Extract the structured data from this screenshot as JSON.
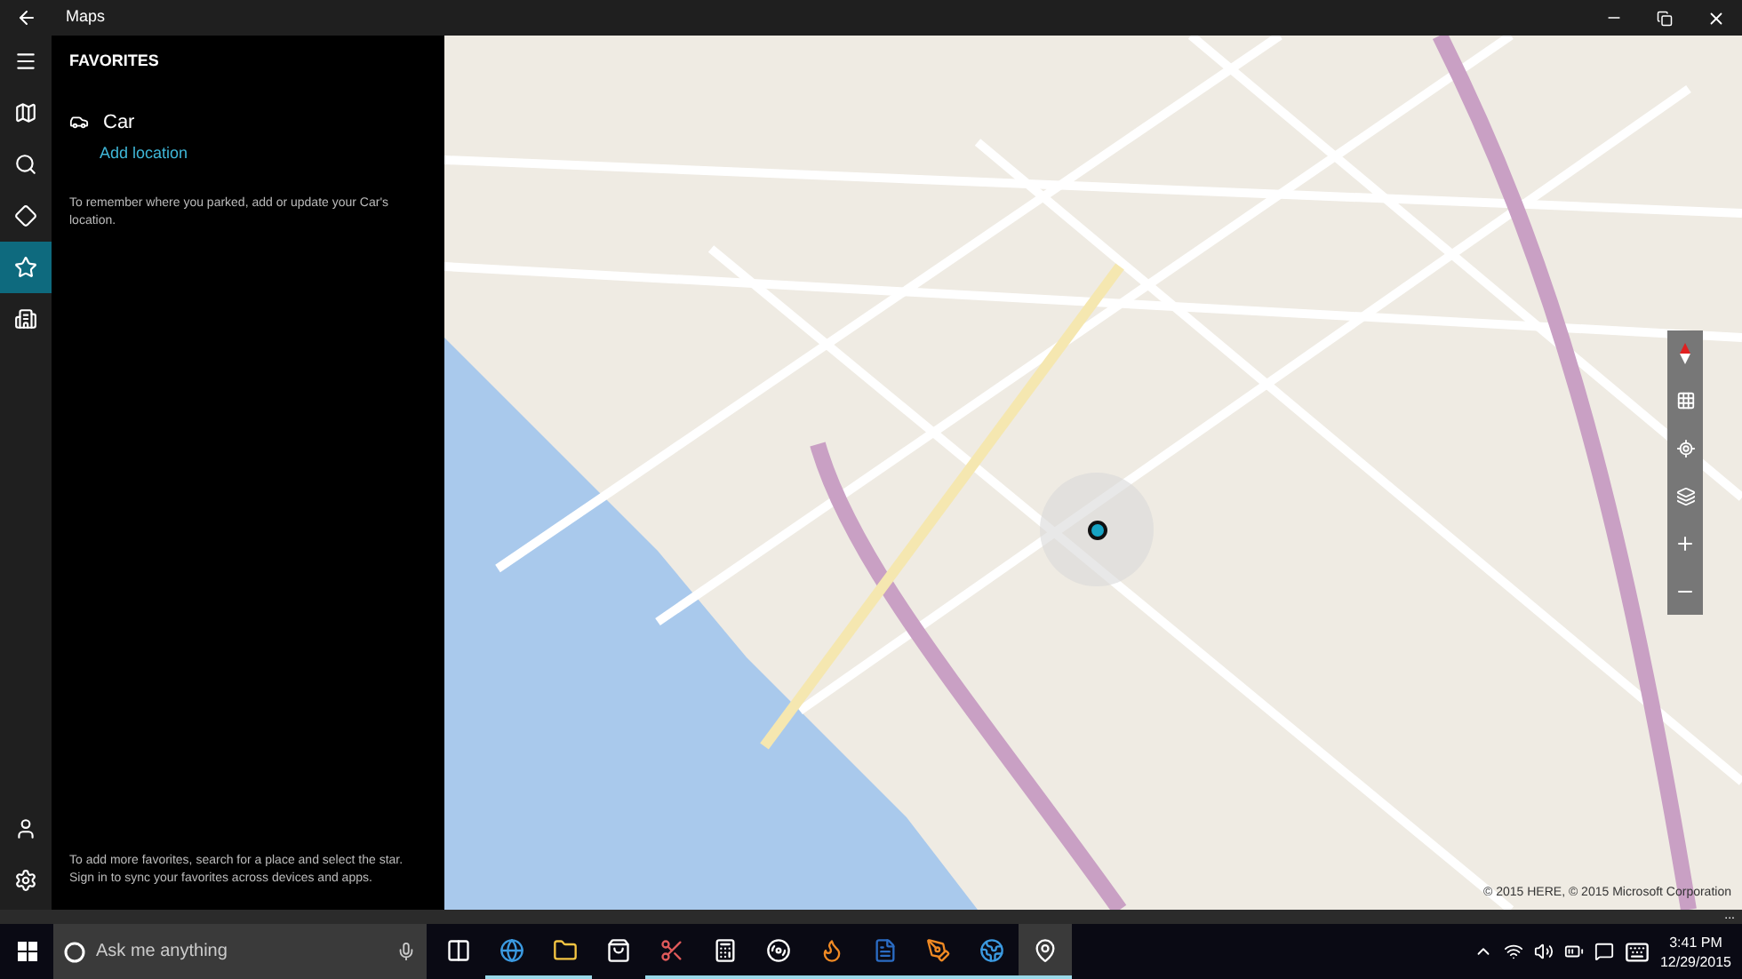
{
  "window": {
    "title": "Maps"
  },
  "nav": {
    "top": [
      {
        "kind": "menu",
        "selected": false
      },
      {
        "kind": "map",
        "selected": false
      },
      {
        "kind": "search",
        "selected": false
      },
      {
        "kind": "directions",
        "selected": false
      },
      {
        "kind": "favorites",
        "selected": true
      },
      {
        "kind": "cities",
        "selected": false
      }
    ],
    "bottom": [
      {
        "kind": "account",
        "selected": false
      },
      {
        "kind": "settings",
        "selected": false
      }
    ]
  },
  "panel": {
    "heading": "FAVORITES",
    "favorite": {
      "name": "Car",
      "action": "Add location"
    },
    "hint": "To remember where you parked, add or update your Car's location.",
    "footer": "To add more favorites, search for a place and select the star. Sign in to sync your favorites across devices and apps."
  },
  "map": {
    "copyright": "© 2015 HERE, © 2015 Microsoft Corporation",
    "more": "..."
  },
  "taskbar": {
    "search_placeholder": "Ask me anything",
    "apps": [
      {
        "kind": "taskview",
        "running": false,
        "selected": false
      },
      {
        "kind": "edge",
        "running": true,
        "selected": false
      },
      {
        "kind": "explorer",
        "running": true,
        "selected": false
      },
      {
        "kind": "store",
        "running": false,
        "selected": false
      },
      {
        "kind": "snip",
        "running": true,
        "selected": false
      },
      {
        "kind": "calculator",
        "running": true,
        "selected": false
      },
      {
        "kind": "groove",
        "running": true,
        "selected": false
      },
      {
        "kind": "firefox",
        "running": true,
        "selected": false
      },
      {
        "kind": "word",
        "running": true,
        "selected": false
      },
      {
        "kind": "illustrator",
        "running": true,
        "selected": false
      },
      {
        "kind": "ie",
        "running": true,
        "selected": false
      },
      {
        "kind": "maps",
        "running": true,
        "selected": true
      }
    ],
    "time": "3:41 PM",
    "date": "12/29/2015"
  }
}
